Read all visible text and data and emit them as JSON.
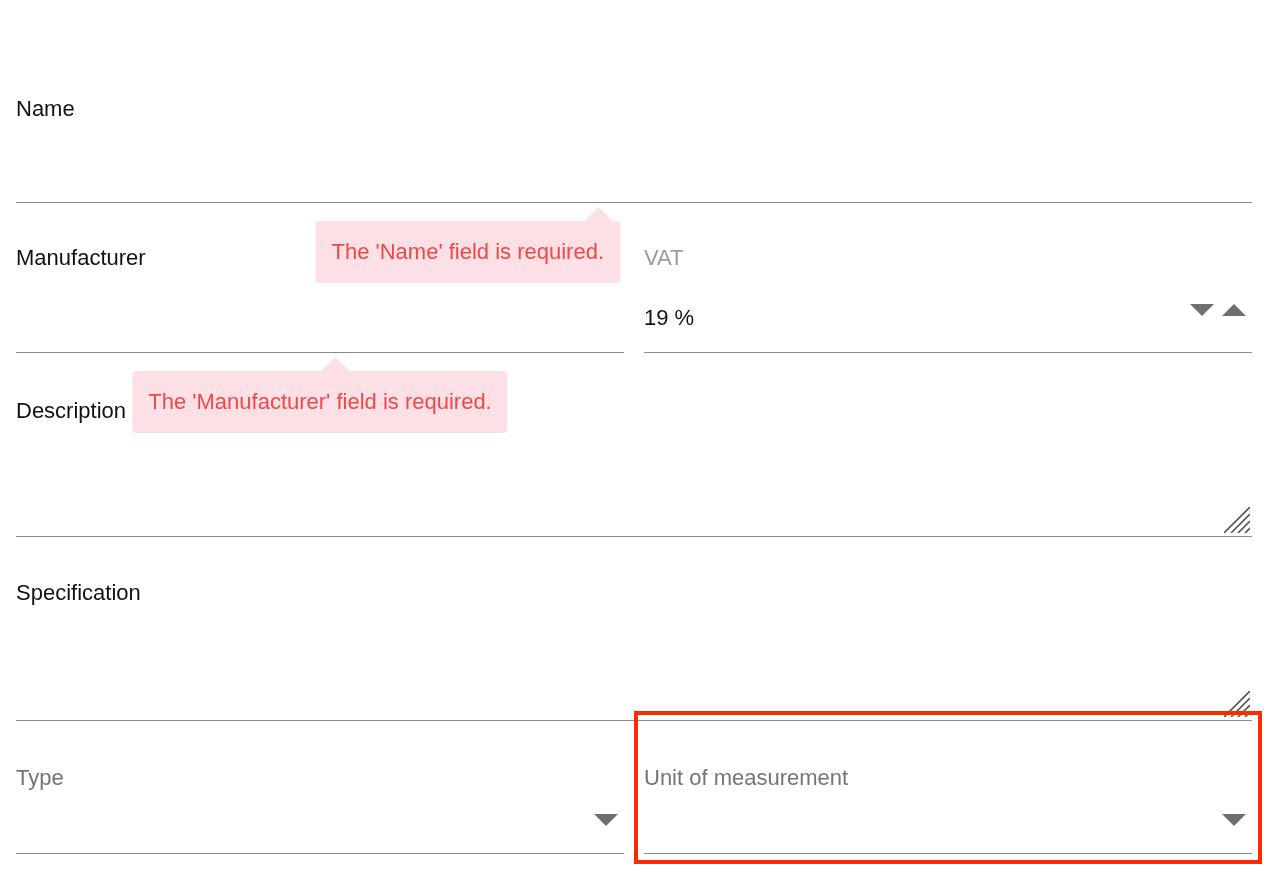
{
  "rows": [
    {
      "fields": [
        {
          "kind": "text",
          "label": "Name",
          "error": "The 'Name' field is required."
        }
      ]
    },
    {
      "fields": [
        {
          "kind": "text",
          "label": "Manufacturer",
          "error": "The 'Manufacturer' field is required."
        },
        {
          "kind": "spin",
          "label": "VAT",
          "value": "19 %"
        }
      ]
    },
    {
      "fields": [
        {
          "kind": "textarea",
          "label": "Description"
        }
      ]
    },
    {
      "fields": [
        {
          "kind": "textarea",
          "label": "Specification"
        }
      ]
    },
    {
      "fields": [
        {
          "kind": "select",
          "label": "Type"
        },
        {
          "kind": "select",
          "label": "Unit of measurement",
          "highlighted": true
        }
      ]
    }
  ]
}
